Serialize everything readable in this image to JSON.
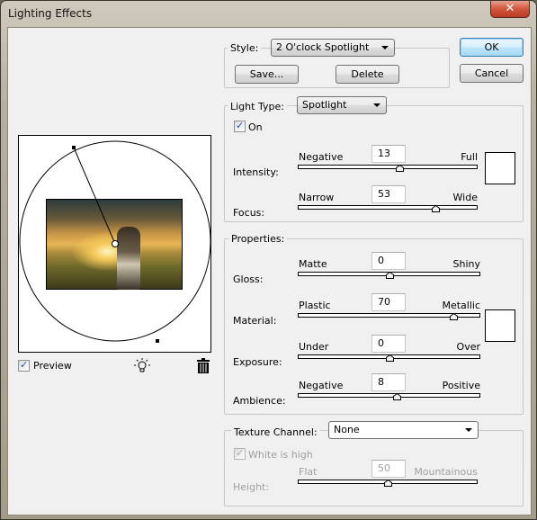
{
  "window": {
    "title": "Lighting Effects",
    "close_glyph": "✕"
  },
  "buttons": {
    "ok": "OK",
    "cancel": "Cancel"
  },
  "style_group": {
    "label": "Style:",
    "selected": "2 O'clock Spotlight",
    "save": "Save...",
    "delete": "Delete"
  },
  "light_type_group": {
    "label": "Light Type:",
    "selected": "Spotlight",
    "on_label": "On",
    "on_checked": true,
    "sliders": [
      {
        "label": "Intensity:",
        "left": "Negative",
        "right": "Full",
        "value": "13",
        "position": 0.565
      },
      {
        "label": "Focus:",
        "left": "Narrow",
        "right": "Wide",
        "value": "53",
        "position": 0.765
      }
    ],
    "light_color": "#ffffff"
  },
  "properties_group": {
    "label": "Properties:",
    "sliders": [
      {
        "label": "Gloss:",
        "left": "Matte",
        "right": "Shiny",
        "value": "0",
        "position": 0.5
      },
      {
        "label": "Material:",
        "left": "Plastic",
        "right": "Metallic",
        "value": "70",
        "position": 0.85
      },
      {
        "label": "Exposure:",
        "left": "Under",
        "right": "Over",
        "value": "0",
        "position": 0.5
      },
      {
        "label": "Ambience:",
        "left": "Negative",
        "right": "Positive",
        "value": "8",
        "position": 0.54
      }
    ],
    "ambient_color": "#ffffff"
  },
  "texture_group": {
    "label": "Texture Channel:",
    "selected": "None",
    "white_is_high_label": "White is high",
    "white_is_high_checked": true,
    "height": {
      "label": "Height:",
      "left": "Flat",
      "right": "Mountainous",
      "value": "50",
      "position": 0.5
    }
  },
  "preview": {
    "label": "Preview",
    "checked": true,
    "light_bulb_icon": "light-bulb-icon",
    "trash_icon": "trash-icon"
  }
}
